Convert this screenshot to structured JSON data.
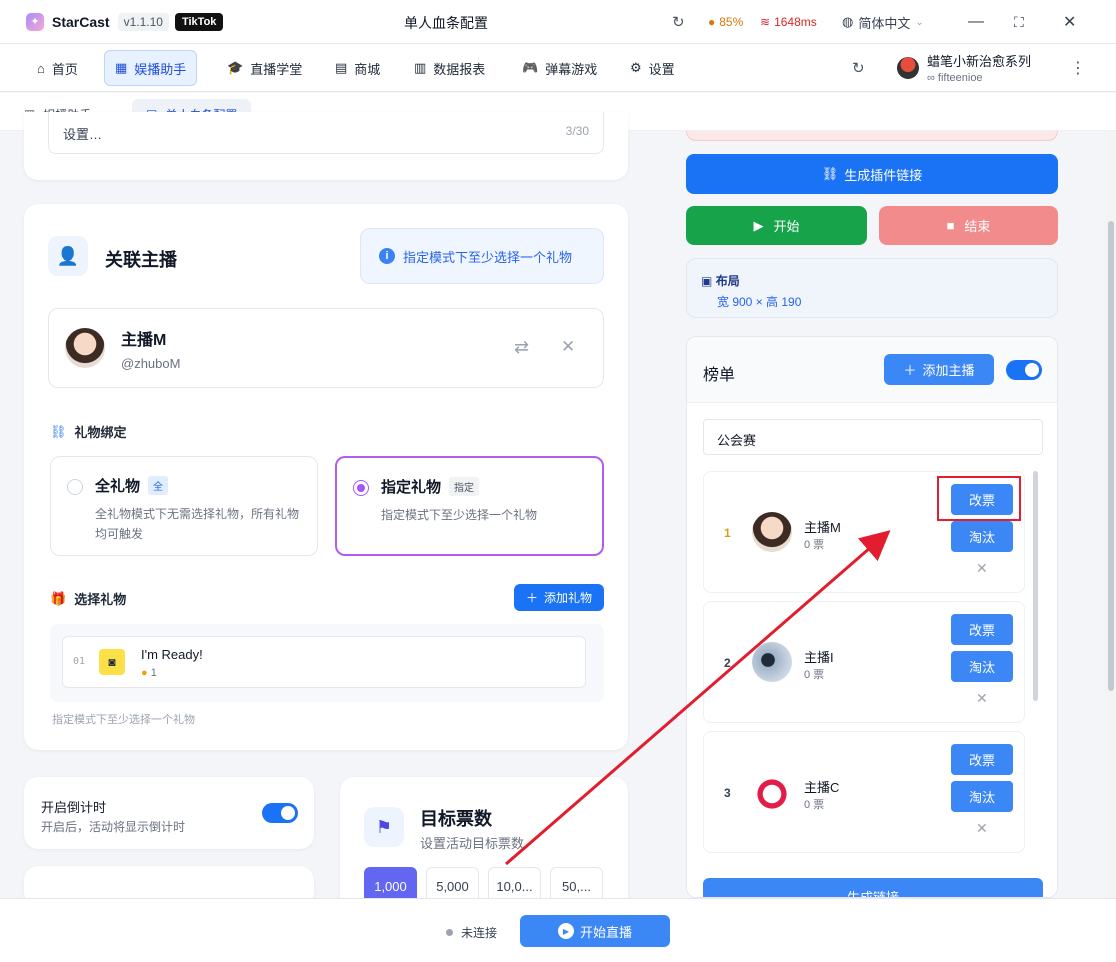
{
  "app": {
    "name": "StarCast",
    "version": "v1.1.10",
    "platform": "TikTok",
    "window_title": "单人血条配置"
  },
  "status": {
    "cpu": "85%",
    "ping": "1648ms",
    "language": "简体中文"
  },
  "nav": {
    "items": [
      "首页",
      "娱播助手",
      "直播学堂",
      "商城",
      "数据报表",
      "弹幕游戏",
      "设置"
    ],
    "active": "娱播助手"
  },
  "user": {
    "name": "蜡笔小新治愈系列",
    "handle": "fifteenioe"
  },
  "tabs": [
    "娱播助手",
    "单人血条配置"
  ],
  "top_field": {
    "value": "设置…",
    "counter": "3/30"
  },
  "link_anchor": {
    "title": "关联主播",
    "tip": "指定模式下至少选择一个礼物",
    "anchor_name": "主播M",
    "anchor_handle": "@zhuboM"
  },
  "gift_binding": {
    "label": "礼物绑定",
    "all_title": "全礼物",
    "all_badge": "全",
    "all_desc": "全礼物模式下无需选择礼物，所有礼物均可触发",
    "spec_title": "指定礼物",
    "spec_badge": "指定",
    "spec_desc": "指定模式下至少选择一个礼物",
    "selected": "指定礼物"
  },
  "gift_select": {
    "label": "选择礼物",
    "add_button": "添加礼物",
    "items": [
      {
        "index": "01",
        "name": "I'm Ready!",
        "price": "1"
      }
    ],
    "hint": "指定模式下至少选择一个礼物"
  },
  "countdown": {
    "title": "开启倒计时",
    "desc": "开启后，活动将显示倒计时",
    "enabled": true
  },
  "target": {
    "title": "目标票数",
    "desc": "设置活动目标票数",
    "amounts": [
      "1,000",
      "5,000",
      "10,0...",
      "50,..."
    ],
    "selected": "1,000"
  },
  "right": {
    "gen_plugin_link": "生成插件链接",
    "start": "开始",
    "end": "结束",
    "layout_label": "布局",
    "layout_value": "宽 900 × 高 190"
  },
  "leaderboard": {
    "title": "榜单",
    "add_anchor": "添加主播",
    "enabled": true,
    "name_value": "公会赛",
    "change_label": "改票",
    "eliminate_label": "淘汰",
    "entries": [
      {
        "rank": "1",
        "name": "主播M",
        "votes": "0 票"
      },
      {
        "rank": "2",
        "name": "主播I",
        "votes": "0 票"
      },
      {
        "rank": "3",
        "name": "主播C",
        "votes": "0 票"
      }
    ],
    "gen_link": "生成链接"
  },
  "footer": {
    "status": "未连接",
    "start_live": "开始直播"
  },
  "colors": {
    "primary": "#1a73f5",
    "green": "#16a34a",
    "red_light": "#f28b8b",
    "purple": "#a855f7"
  }
}
